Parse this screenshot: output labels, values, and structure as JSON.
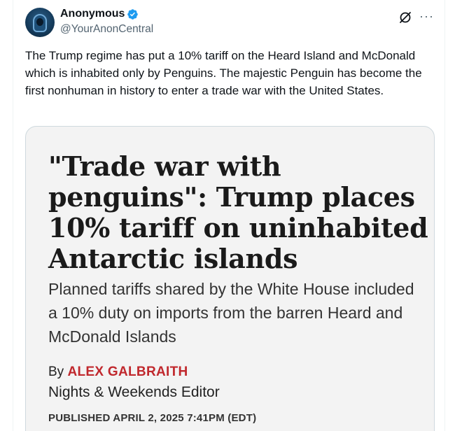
{
  "author": {
    "display_name": "Anonymous",
    "handle": "@YourAnonCentral",
    "verified_icon": "verified-badge-icon"
  },
  "tweet": {
    "text": "The Trump regime has put a 10% tariff on the Heard Island and McDonald which is inhabited only by Penguins. The majestic Penguin has become the first nonhuman in history to enter a trade war with the United States."
  },
  "actions": {
    "grok_icon": "grok-icon",
    "more_label": "···"
  },
  "article_card": {
    "headline": "\"Trade war with penguins\": Trump places 10% tariff on uninhabited Antarctic islands",
    "subheadline": "Planned tariffs shared by the White House included a 10% duty on imports from the barren Heard and McDonald Islands",
    "by_prefix": "By",
    "author_name": "ALEX GALBRAITH",
    "author_role": "Nights & Weekends Editor",
    "published": "PUBLISHED APRIL 2, 2025 7:41PM (EDT)"
  },
  "colors": {
    "verified": "#1d9bf0",
    "byline_author": "#c0282d",
    "card_background": "#f3f3f3"
  }
}
